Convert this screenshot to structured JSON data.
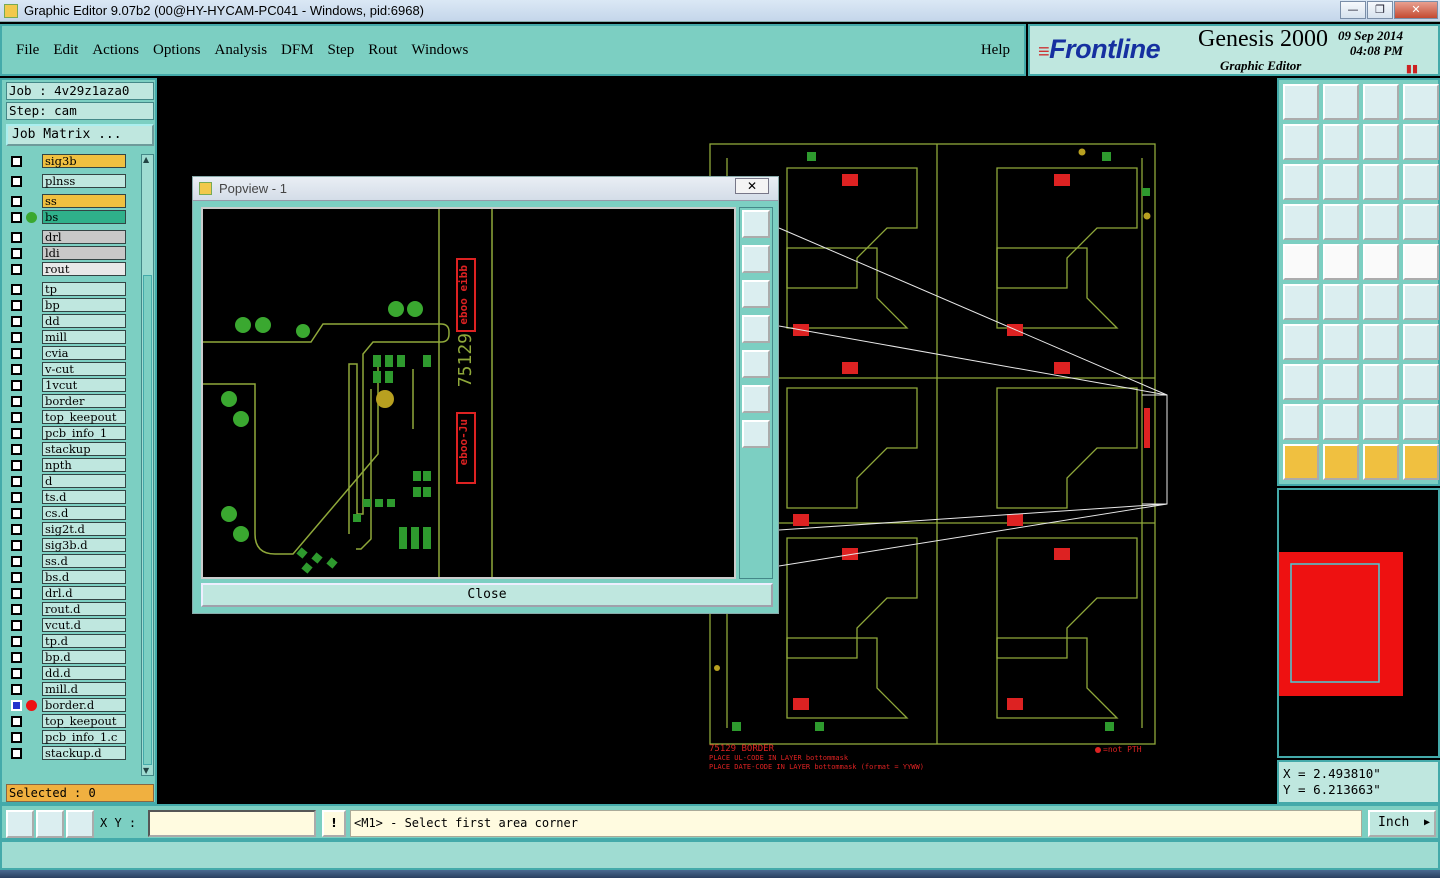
{
  "window": {
    "title": "Graphic Editor 9.07b2 (00@HY-HYCAM-PC041 - Windows, pid:6968)",
    "minimize": "—",
    "maximize": "❐",
    "close": "✕"
  },
  "menu": {
    "items": [
      "File",
      "Edit",
      "Actions",
      "Options",
      "Analysis",
      "DFM",
      "Step",
      "Rout",
      "Windows"
    ],
    "help": "Help"
  },
  "brand": {
    "logo": "Frontline",
    "product": "Genesis 2000",
    "subtitle": "Graphic Editor",
    "date": "09  Sep  2014",
    "time": "04:08  PM"
  },
  "left": {
    "job": "Job : 4v29z1aza0",
    "step": "Step: cam",
    "job_matrix": "Job Matrix ...",
    "selected": "Selected : 0",
    "layers": [
      {
        "name": "sig3b",
        "color": "#f0c040",
        "dot": ""
      },
      {
        "name": "plnss",
        "color": "#bfe7df",
        "dot": ""
      },
      {
        "name": "ss",
        "color": "#f0c040",
        "dot": ""
      },
      {
        "name": "bs",
        "color": "#2fb08a",
        "dot": "#3aa830"
      },
      {
        "name": "drl",
        "color": "#c8c8c8",
        "dot": ""
      },
      {
        "name": "ldi",
        "color": "#c8c8c8",
        "dot": ""
      },
      {
        "name": "rout",
        "color": "#e8e8e8",
        "dot": ""
      },
      {
        "name": "tp",
        "color": "#bfe7df",
        "dot": ""
      },
      {
        "name": "bp",
        "color": "#bfe7df",
        "dot": ""
      },
      {
        "name": "dd",
        "color": "#bfe7df",
        "dot": ""
      },
      {
        "name": "mill",
        "color": "#bfe7df",
        "dot": ""
      },
      {
        "name": "cvia",
        "color": "#bfe7df",
        "dot": ""
      },
      {
        "name": "v-cut",
        "color": "#bfe7df",
        "dot": ""
      },
      {
        "name": "1vcut",
        "color": "#bfe7df",
        "dot": ""
      },
      {
        "name": "border",
        "color": "#bfe7df",
        "dot": ""
      },
      {
        "name": "top_keepout",
        "color": "#bfe7df",
        "dot": ""
      },
      {
        "name": "pcb_info_1",
        "color": "#bfe7df",
        "dot": ""
      },
      {
        "name": "stackup",
        "color": "#bfe7df",
        "dot": ""
      },
      {
        "name": "npth",
        "color": "#bfe7df",
        "dot": ""
      },
      {
        "name": "d",
        "color": "#bfe7df",
        "dot": ""
      },
      {
        "name": "ts.d",
        "color": "#bfe7df",
        "dot": ""
      },
      {
        "name": "cs.d",
        "color": "#bfe7df",
        "dot": ""
      },
      {
        "name": "sig2t.d",
        "color": "#bfe7df",
        "dot": ""
      },
      {
        "name": "sig3b.d",
        "color": "#bfe7df",
        "dot": ""
      },
      {
        "name": "ss.d",
        "color": "#bfe7df",
        "dot": ""
      },
      {
        "name": "bs.d",
        "color": "#bfe7df",
        "dot": ""
      },
      {
        "name": "drl.d",
        "color": "#bfe7df",
        "dot": ""
      },
      {
        "name": "rout.d",
        "color": "#bfe7df",
        "dot": ""
      },
      {
        "name": "vcut.d",
        "color": "#bfe7df",
        "dot": ""
      },
      {
        "name": "tp.d",
        "color": "#bfe7df",
        "dot": ""
      },
      {
        "name": "bp.d",
        "color": "#bfe7df",
        "dot": ""
      },
      {
        "name": "dd.d",
        "color": "#bfe7df",
        "dot": ""
      },
      {
        "name": "mill.d",
        "color": "#bfe7df",
        "dot": ""
      },
      {
        "name": "border.d",
        "color": "#bfe7df",
        "dot": "#ee1111"
      },
      {
        "name": "top_keepout",
        "color": "#bfe7df",
        "dot": ""
      },
      {
        "name": "pcb_info_1.c",
        "color": "#bfe7df",
        "dot": ""
      },
      {
        "name": "stackup.d",
        "color": "#bfe7df",
        "dot": ""
      }
    ]
  },
  "popview": {
    "title": "Popview - 1",
    "close_x": "✕",
    "close_button": "Close",
    "text_upper": "eboo eibb",
    "text_mid": "75129",
    "text_lower": "eboo-Ju"
  },
  "canvas": {
    "note_line1": "75129   BORDER",
    "note_line2": "PLACE UL-CODE IN LAYER bottommask",
    "note_line3": "PLACE DATE-CODE IN LAYER bottommask (format = YYWW)",
    "legend": "=not PTH"
  },
  "coords": {
    "x": "X = 2.493810\"",
    "y": "Y = 6.213663\""
  },
  "bottom": {
    "xy_label": "X Y :",
    "xy_value": "",
    "warn": "!",
    "prompt": "<M1> - Select first area corner",
    "units": "Inch",
    "units_arrow": "▶"
  },
  "colors": {
    "panel": "#7ccfc2",
    "pcb_trace": "#8fa83a",
    "pad_green": "#2e9a2e",
    "label_red": "#dd2222"
  }
}
